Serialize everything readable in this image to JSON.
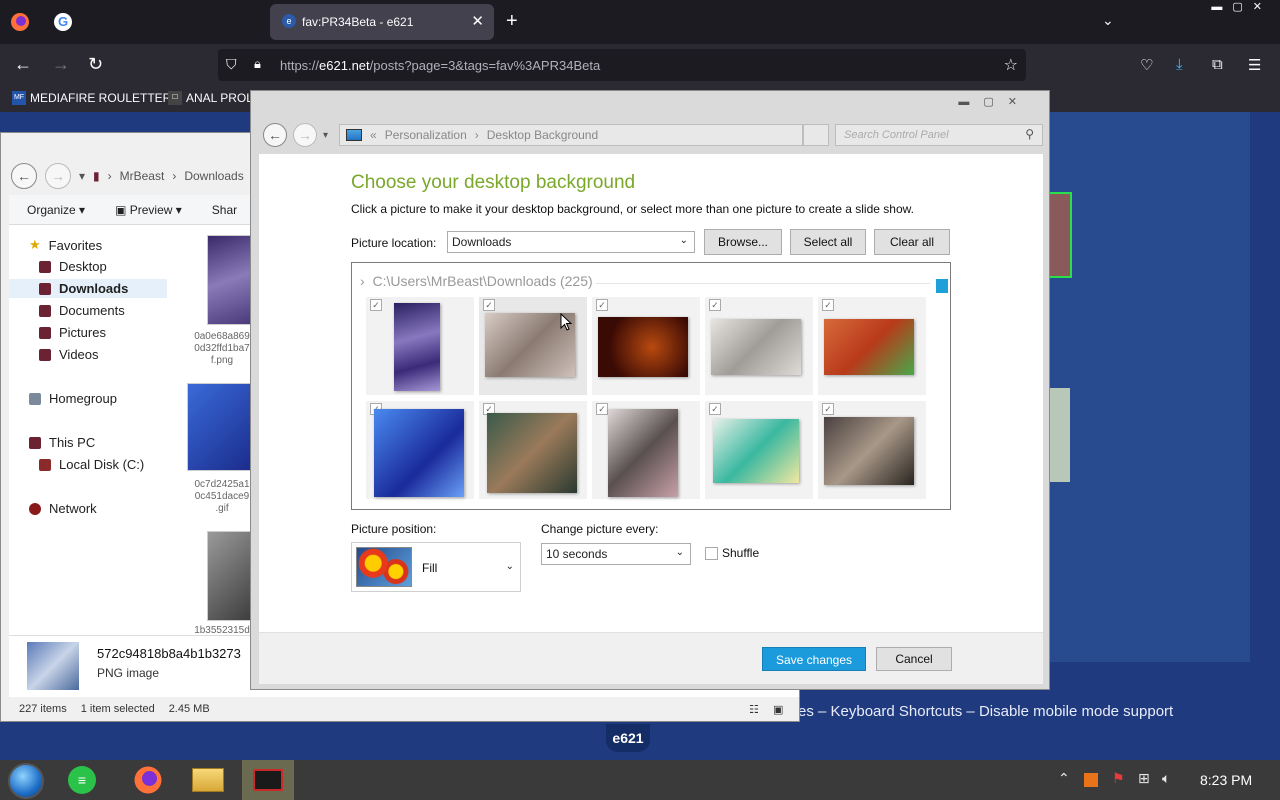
{
  "browser": {
    "active_tab_title": "fav:PR34Beta - e621",
    "url_prefix": "https://",
    "url_domain": "e621.net",
    "url_path": "/posts?page=3&tags=fav%3APR34Beta",
    "bookmarks": [
      "MEDIAFIRE ROULETTER",
      "ANAL PROL"
    ],
    "favicon_letter": "e",
    "google_letter": "G"
  },
  "page": {
    "footer_text": "es – Keyboard Shortcuts – Disable mobile mode support",
    "logo": "e621"
  },
  "explorer": {
    "path": [
      "MrBeast",
      "Downloads"
    ],
    "toolbar": [
      "Organize",
      "Preview",
      "Shar"
    ],
    "nav": {
      "favorites": "Favorites",
      "desktop": "Desktop",
      "downloads": "Downloads",
      "documents": "Documents",
      "pictures": "Pictures",
      "videos": "Videos",
      "homegroup": "Homegroup",
      "thispc": "This PC",
      "localdisk": "Local Disk (C:)",
      "network": "Network"
    },
    "files": [
      {
        "name": "0a0e68a869\n0d32ffd1ba7\nf.png"
      },
      {
        "name": "0c7d2425a1\n0c451dace9\n.gif"
      },
      {
        "name": "1b3552315d"
      }
    ],
    "detail_name": "572c94818b8a4b1b3273",
    "detail_type": "PNG image",
    "status_count": "227 items",
    "status_selected": "1 item selected",
    "status_size": "2.45 MB"
  },
  "control_panel": {
    "breadcrumb": [
      "Personalization",
      "Desktop Background"
    ],
    "search_placeholder": "Search Control Panel",
    "heading": "Choose your desktop background",
    "subtext": "Click a picture to make it your desktop background, or select more than one picture to create a slide show.",
    "picture_location_label": "Picture location:",
    "picture_location_value": "Downloads",
    "browse_label": "Browse...",
    "select_all_label": "Select all",
    "clear_all_label": "Clear all",
    "gallery_header": "C:\\Users\\MrBeast\\Downloads (225)",
    "picture_position_label": "Picture position:",
    "picture_position_value": "Fill",
    "change_every_label": "Change picture every:",
    "change_every_value": "10 seconds",
    "shuffle_label": "Shuffle",
    "save_label": "Save changes",
    "cancel_label": "Cancel"
  },
  "taskbar": {
    "clock": "8:23 PM"
  },
  "colors": {
    "accent_heading": "#7aa82a",
    "save_button": "#1b9bdb",
    "page_bg": "#1f3a7e"
  }
}
